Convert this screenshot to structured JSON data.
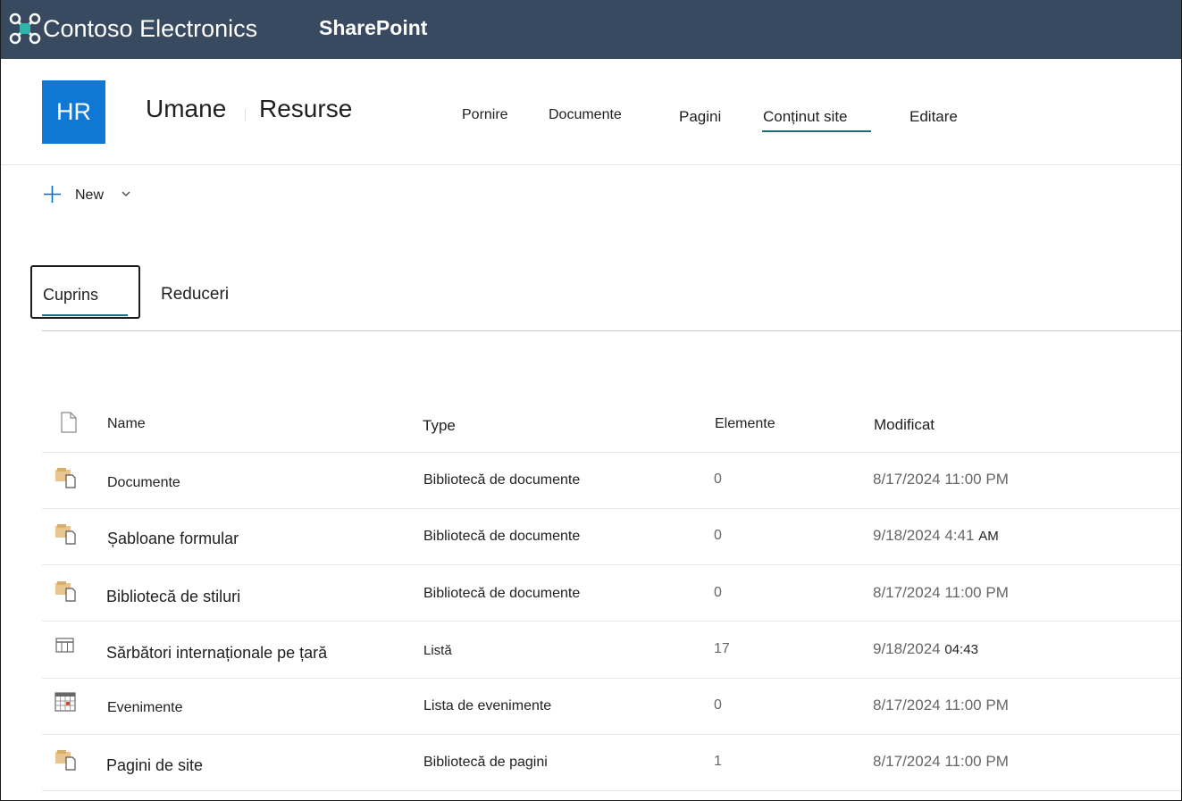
{
  "suitebar": {
    "org_name": "Contoso Electronics",
    "app_name": "SharePoint",
    "bg_color": "#374a60"
  },
  "site": {
    "logo_initials": "HR",
    "logo_color": "#0f78d4",
    "title_part1": "Umane",
    "title_part2": "Resurse",
    "nav": [
      {
        "label": "Pornire"
      },
      {
        "label": "Documente"
      },
      {
        "label": "Pagini"
      },
      {
        "label": "Conținut site",
        "selected": true
      },
      {
        "label": "Editare"
      }
    ]
  },
  "command_bar": {
    "new_label": "New",
    "icons": [
      "plus-icon",
      "chevron-down-icon"
    ]
  },
  "tabs": [
    {
      "label": "Cuprins",
      "selected": true
    },
    {
      "label": "Reduceri"
    }
  ],
  "list": {
    "columns": {
      "icon": "file-icon",
      "name": "Name",
      "type": "Type",
      "items": "Elemente",
      "modified": "Modificat"
    },
    "rows": [
      {
        "icon": "document-library-icon",
        "name": "Documente",
        "type": "Bibliotecă de documente",
        "items": "0",
        "modified": "8/17/2024 11:00 PM",
        "modified_suffix": ""
      },
      {
        "icon": "document-library-icon",
        "name": "Șabloane formular",
        "type": "Bibliotecă de documente",
        "items": "0",
        "modified": "9/18/2024 4:41",
        "modified_suffix": "AM"
      },
      {
        "icon": "document-library-icon",
        "name": "Bibliotecă de stiluri",
        "type": "Bibliotecă de documente",
        "items": "0",
        "modified": "8/17/2024 11:00 PM",
        "modified_suffix": ""
      },
      {
        "icon": "list-icon",
        "name": "Sărbători internaționale pe țară",
        "type": "Listă",
        "items": "17",
        "modified": "9/18/2024",
        "modified_suffix": "04:43"
      },
      {
        "icon": "calendar-icon",
        "name": "Evenimente",
        "type": "Lista de evenimente",
        "items": "0",
        "modified": "8/17/2024 11:00 PM",
        "modified_suffix": ""
      },
      {
        "icon": "document-library-icon",
        "name": "Pagini de site",
        "type": "Bibliotecă de pagini",
        "items": "1",
        "modified": "8/17/2024 11:00 PM",
        "modified_suffix": ""
      }
    ]
  }
}
